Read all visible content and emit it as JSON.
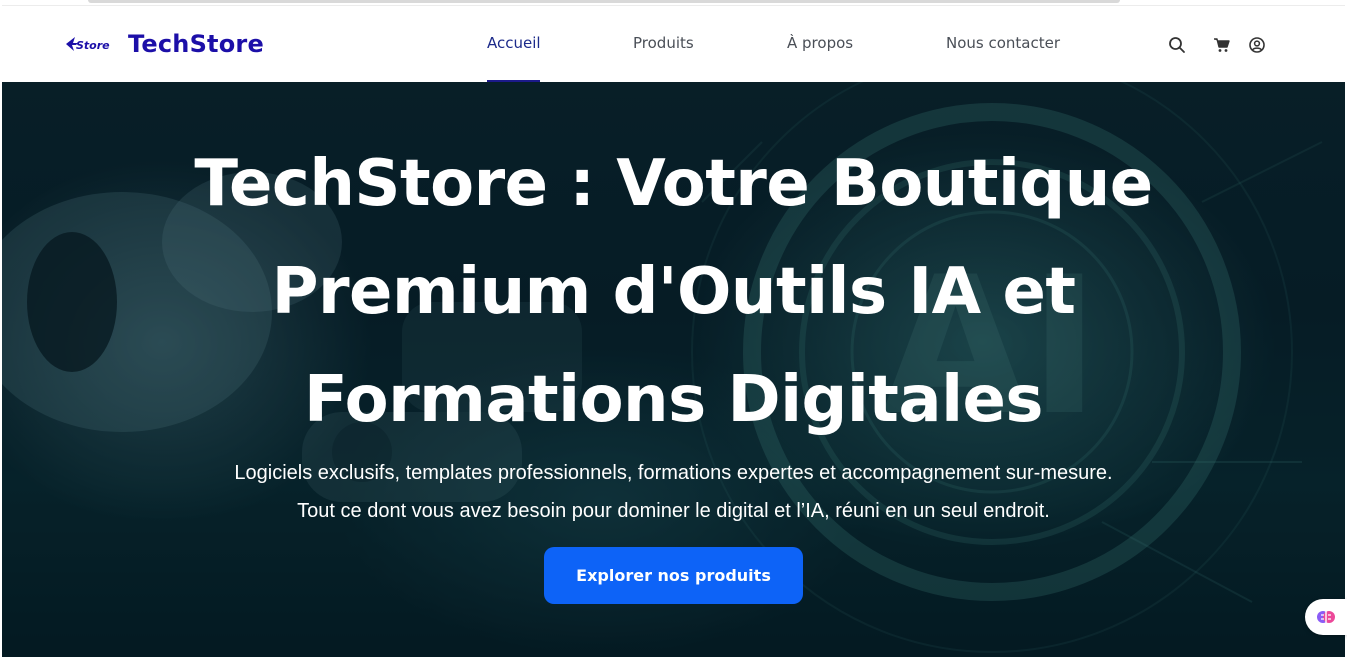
{
  "brand": {
    "logo_text": "Store",
    "name": "TechStore",
    "color": "#1c0fa8"
  },
  "nav": {
    "links": [
      {
        "label": "Accueil",
        "active": true
      },
      {
        "label": "Produits",
        "active": false
      },
      {
        "label": "À propos",
        "active": false
      },
      {
        "label": "Nous contacter",
        "active": false
      }
    ],
    "icons": [
      "search-icon",
      "cart-icon",
      "account-icon"
    ]
  },
  "hero": {
    "title_lines": [
      "TechStore : Votre Boutique",
      "Premium d'Outils IA et",
      "Formations Digitales"
    ],
    "subtitle_lines": [
      "Logiciels exclusifs, templates professionnels, formations expertes et accompagnement sur-mesure.",
      "Tout ce dont vous avez besoin pour dominer le digital et l’IA, réuni en un seul endroit."
    ],
    "cta_label": "Explorer nos produits",
    "cta_color": "#0d63f7"
  },
  "widget": {
    "icon": "brain-icon"
  }
}
